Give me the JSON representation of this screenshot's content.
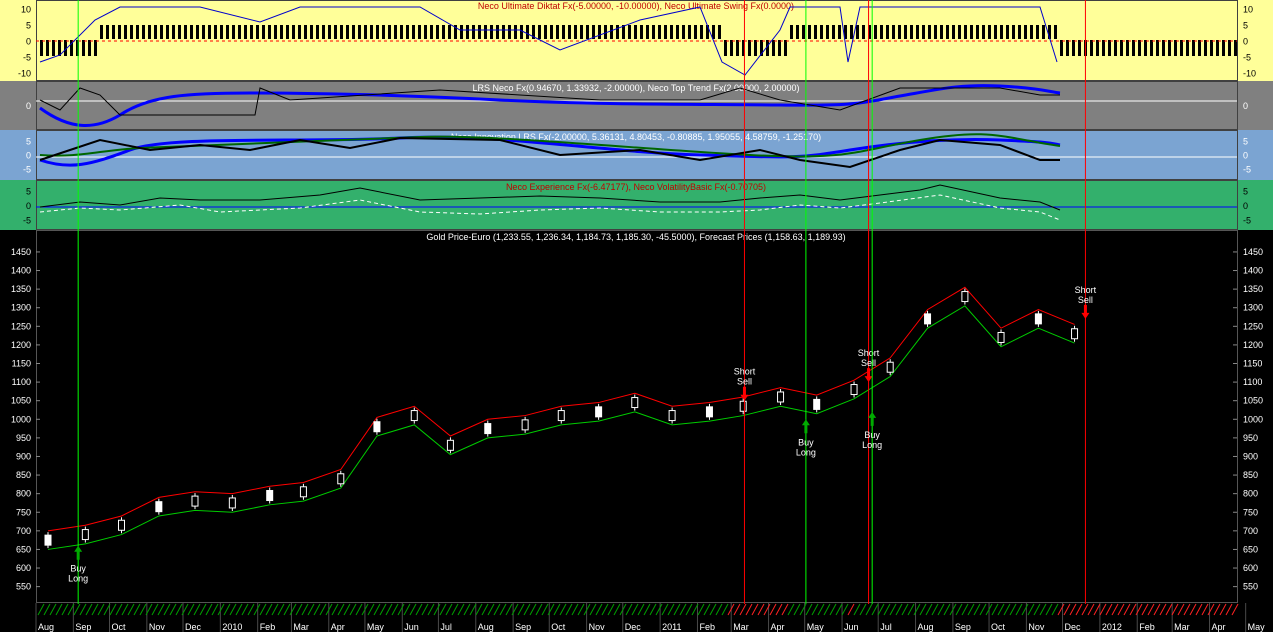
{
  "panels": {
    "p1": {
      "title": "Neco Ultimate Diktat Fx(-5.00000, -10.00000), Neco Ultimate Swing Fx(0.0000)",
      "ticks": [
        "10",
        "5",
        "0",
        "-5",
        "-10"
      ],
      "tick_values": [
        10,
        5,
        0,
        -5,
        -10
      ],
      "bg": "#ffff99"
    },
    "p2": {
      "title": "LRS Neco Fx(0.94670, 1.33932, -2.00000), Neco Top Trend Fx(2.00000, 2.00000)",
      "ticks": [
        "0"
      ],
      "tick_values": [
        0
      ],
      "bg": "#808080"
    },
    "p3": {
      "title": "Neco Innovation LRS Fx(-2.00000, 5.36131, 4.80453, -0.80885, 1.95055, 4.58759, -1.25170)",
      "ticks": [
        "5",
        "0",
        "-5"
      ],
      "tick_values": [
        5,
        0,
        -5
      ],
      "bg": "#7ba4d2"
    },
    "p4": {
      "title": "Neco Experience Fx(-6.47177), Neco VolatilityBasic Fx(-0.70705)",
      "ticks": [
        "5",
        "0",
        "-5"
      ],
      "tick_values": [
        5,
        0,
        -5
      ],
      "bg": "#33b06c"
    },
    "price": {
      "title": "Gold Price-Euro (1,233.55, 1,236.34, 1,184.73, 1,185.30, -45.5000), Forecast Prices (1,158.63, 1,189.93)",
      "bg": "#000000"
    }
  },
  "price_axis_ticks": [
    "1450",
    "1400",
    "1350",
    "1300",
    "1250",
    "1200",
    "1150",
    "1100",
    "1050",
    "1000",
    "950",
    "900",
    "850",
    "800",
    "750",
    "700",
    "650",
    "600",
    "550"
  ],
  "x_axis_labels": [
    "Aug",
    "Sep",
    "Oct",
    "Nov",
    "Dec",
    "2010",
    "Feb",
    "Mar",
    "Apr",
    "May",
    "Jun",
    "Jul",
    "Aug",
    "Sep",
    "Oct",
    "Nov",
    "Dec",
    "2011",
    "Feb",
    "Mar",
    "Apr",
    "May",
    "Jun",
    "Jul",
    "Aug",
    "Sep",
    "Oct",
    "Nov",
    "Dec",
    "2012",
    "Feb",
    "Mar",
    "Apr",
    "May"
  ],
  "signals": [
    {
      "date": "2009-09-05",
      "label1": "Buy",
      "label2": "Long",
      "kind": "buy",
      "price": 660
    },
    {
      "date": "2011-03-12",
      "label1": "Short",
      "label2": "Sell",
      "kind": "sell",
      "price": 1050
    },
    {
      "date": "2011-05-02",
      "label1": "Buy",
      "label2": "Long",
      "kind": "buy",
      "price": 1000
    },
    {
      "date": "2011-06-23",
      "label1": "Short",
      "label2": "Sell",
      "kind": "sell",
      "price": 1100
    },
    {
      "date": "2011-06-26",
      "label1": "Buy",
      "label2": "Long",
      "kind": "buy",
      "price": 1020
    },
    {
      "date": "2011-12-20",
      "label1": "Short",
      "label2": "Sell",
      "kind": "sell",
      "price": 1270
    }
  ],
  "colors": {
    "up_line": "#ff0000",
    "down_line": "#00cc00",
    "buy_arrow": "#00aa00",
    "sell_arrow": "#ff0000",
    "signal_line_buy": "#00ff00",
    "signal_line_sell": "#ff0000"
  },
  "chart_data": {
    "type": "line",
    "title": "Gold Price-Euro (1,233.55, 1,236.34, 1,184.73, 1,185.30, -45.5000), Forecast Prices (1,158.63, 1,189.93)",
    "xlabel": "",
    "ylabel": "",
    "ylim": [
      510,
      1470
    ],
    "x": [
      "2009-08-01",
      "2009-09-01",
      "2009-10-01",
      "2009-11-01",
      "2009-12-01",
      "2010-01-01",
      "2010-02-01",
      "2010-03-01",
      "2010-04-01",
      "2010-05-01",
      "2010-06-01",
      "2010-07-01",
      "2010-08-01",
      "2010-09-01",
      "2010-10-01",
      "2010-11-01",
      "2010-12-01",
      "2011-01-01",
      "2011-02-01",
      "2011-03-01",
      "2011-04-01",
      "2011-05-01",
      "2011-06-01",
      "2011-07-01",
      "2011-08-01",
      "2011-09-01",
      "2011-10-01",
      "2011-11-01",
      "2011-12-01"
    ],
    "series": [
      {
        "values": [
          675,
          690,
          715,
          765,
          780,
          775,
          795,
          805,
          840,
          980,
          1010,
          930,
          975,
          985,
          1010,
          1020,
          1045,
          1010,
          1020,
          1035,
          1060,
          1040,
          1080,
          1140,
          1270,
          1330,
          1220,
          1270,
          1230
        ]
      }
    ],
    "last_bar": {
      "open": 1233.55,
      "high": 1236.34,
      "low": 1184.73,
      "close": 1185.3,
      "change": -45.5
    },
    "forecast": [
      1158.63,
      1189.93
    ]
  }
}
